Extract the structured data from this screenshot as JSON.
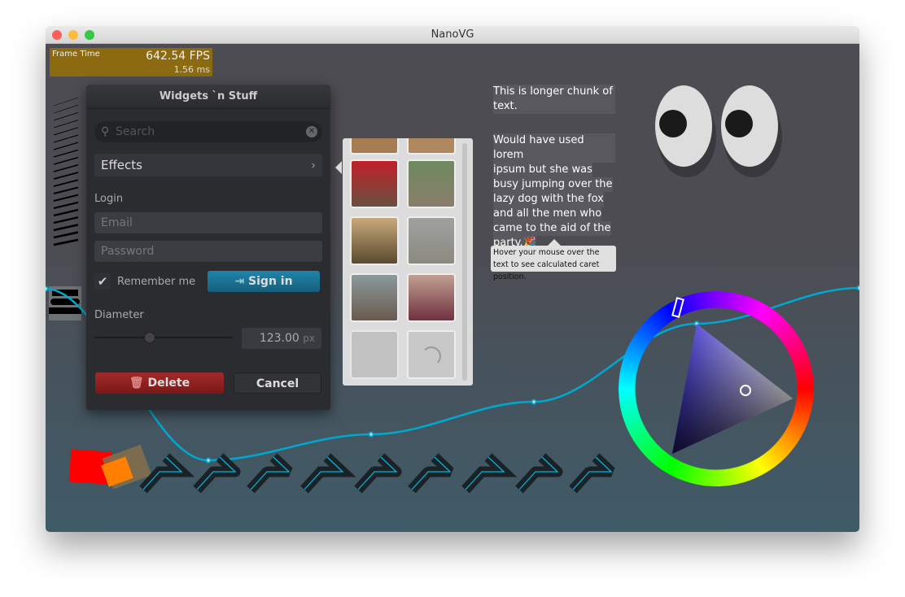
{
  "window": {
    "title": "NanoVG"
  },
  "perf": {
    "label": "Frame Time",
    "fps": "642.54 FPS",
    "ms": "1.56 ms"
  },
  "panel": {
    "title": "Widgets `n Stuff",
    "search_placeholder": "Search",
    "effects": "Effects",
    "login_label": "Login",
    "email_placeholder": "Email",
    "password_placeholder": "Password",
    "remember": "Remember me",
    "remember_checked": true,
    "signin": "Sign in",
    "diameter_label": "Diameter",
    "diameter_value": "123.00",
    "diameter_unit": "px",
    "slider_fraction": 0.4,
    "delete": "Delete",
    "cancel": "Cancel"
  },
  "text": {
    "para1": "This is longer chunk of text.",
    "para2_lines": [
      "Would have used lorem",
      "ipsum but she    was",
      "busy jumping over the",
      "lazy dog with the fox",
      "and all the men who",
      "came to the aid of the",
      "party.🎉"
    ],
    "tooltip": "Hover your mouse over the text to see calculated caret position."
  },
  "colors": {
    "accent": "#00b4e0",
    "fps_bg": "#8c6a10",
    "signin": "#1a6e8e",
    "delete": "#8e1b1b"
  },
  "icons": {
    "search": "search-icon",
    "clear": "clear-icon",
    "chevron": "chevron-right-icon",
    "check": "checkmark-icon",
    "login": "login-icon",
    "trash": "trash-icon"
  }
}
